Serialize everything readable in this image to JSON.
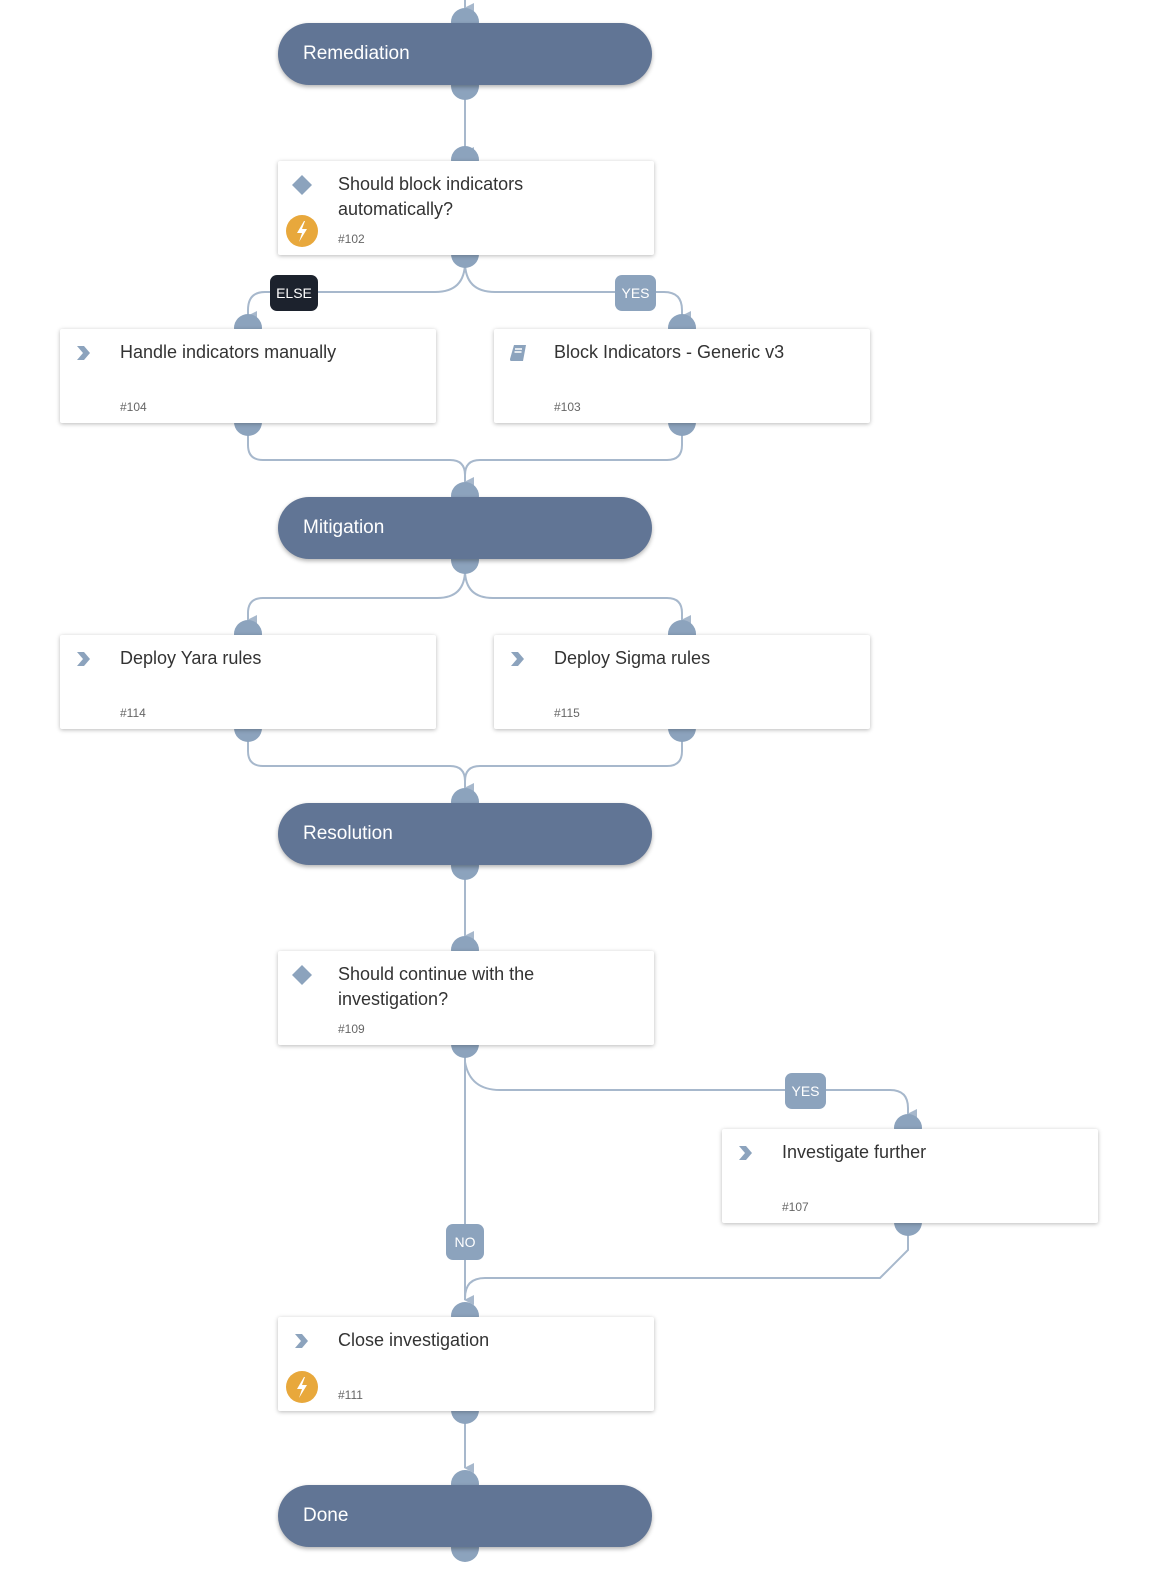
{
  "colors": {
    "section_bg": "#617595",
    "connector": "#8ca3bd",
    "edge": "#a7b8cc",
    "label_bg": "#8ca3bd",
    "else_bg": "#1c222d",
    "automation_badge": "#e8a83c"
  },
  "sections": [
    {
      "id": "remediation",
      "label": "Remediation"
    },
    {
      "id": "mitigation",
      "label": "Mitigation"
    },
    {
      "id": "resolution",
      "label": "Resolution"
    },
    {
      "id": "done",
      "label": "Done"
    }
  ],
  "tasks": [
    {
      "id": "t102",
      "title": "Should block indicators automatically?",
      "number": "#102",
      "type": "condition",
      "icon": "diamond-icon",
      "automated": true
    },
    {
      "id": "t104",
      "title": "Handle indicators manually",
      "number": "#104",
      "type": "manual",
      "icon": "chevron-right-icon",
      "automated": false
    },
    {
      "id": "t103",
      "title": "Block Indicators - Generic v3",
      "number": "#103",
      "type": "playbook",
      "icon": "book-icon",
      "automated": false
    },
    {
      "id": "t114",
      "title": "Deploy Yara rules",
      "number": "#114",
      "type": "manual",
      "icon": "chevron-right-icon",
      "automated": false
    },
    {
      "id": "t115",
      "title": "Deploy Sigma rules",
      "number": "#115",
      "type": "manual",
      "icon": "chevron-right-icon",
      "automated": false
    },
    {
      "id": "t109",
      "title": "Should continue with the investigation?",
      "number": "#109",
      "type": "condition",
      "icon": "diamond-icon",
      "automated": false
    },
    {
      "id": "t107",
      "title": "Investigate further",
      "number": "#107",
      "type": "manual",
      "icon": "chevron-right-icon",
      "automated": false
    },
    {
      "id": "t111",
      "title": "Close investigation",
      "number": "#111",
      "type": "manual",
      "icon": "chevron-right-icon",
      "automated": true
    }
  ],
  "branch_labels": [
    {
      "id": "else-102",
      "text": "ELSE",
      "from": "#102",
      "to": "#104"
    },
    {
      "id": "yes-102",
      "text": "YES",
      "from": "#102",
      "to": "#103"
    },
    {
      "id": "yes-109",
      "text": "YES",
      "from": "#109",
      "to": "#107"
    },
    {
      "id": "no-109",
      "text": "NO",
      "from": "#109",
      "to": "#111"
    }
  ],
  "edges": [
    {
      "from": "Remediation",
      "to": "#102"
    },
    {
      "from": "#102",
      "to": "#104",
      "label": "ELSE"
    },
    {
      "from": "#102",
      "to": "#103",
      "label": "YES"
    },
    {
      "from": "#104",
      "to": "Mitigation"
    },
    {
      "from": "#103",
      "to": "Mitigation"
    },
    {
      "from": "Mitigation",
      "to": "#114"
    },
    {
      "from": "Mitigation",
      "to": "#115"
    },
    {
      "from": "#114",
      "to": "Resolution"
    },
    {
      "from": "#115",
      "to": "Resolution"
    },
    {
      "from": "Resolution",
      "to": "#109"
    },
    {
      "from": "#109",
      "to": "#107",
      "label": "YES"
    },
    {
      "from": "#109",
      "to": "#111",
      "label": "NO"
    },
    {
      "from": "#107",
      "to": "#111"
    },
    {
      "from": "#111",
      "to": "Done"
    }
  ]
}
